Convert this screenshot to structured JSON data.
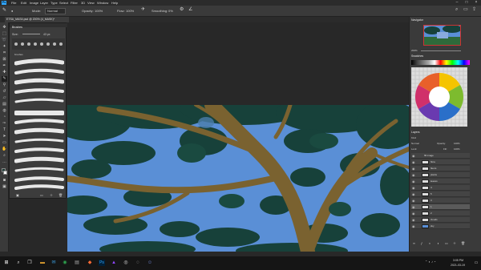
{
  "menubar": {
    "app_icon": "Ps",
    "items": [
      "File",
      "Edit",
      "Image",
      "Layer",
      "Type",
      "Select",
      "Filter",
      "3D",
      "View",
      "Window",
      "Help"
    ]
  },
  "options": {
    "mode_label": "Mode:",
    "mode_value": "Normal",
    "opacity_label": "Opacity:",
    "opacity_value": "100%",
    "flow_label": "Flow:",
    "flow_value": "100%",
    "smoothing_label": "Smoothing:",
    "smoothing_value": "0%"
  },
  "document": {
    "tab_title": "ETSA_MAS4.psd @ 200% (4_MASK)*"
  },
  "brush_panel": {
    "title": "Brushes",
    "size_label": "Size:",
    "size_value": "43 px",
    "group_label": "brushes"
  },
  "navigator": {
    "title": "Navigator",
    "zoom": "200%"
  },
  "swatches": {
    "title": "Swatches"
  },
  "layers": {
    "title": "Layers",
    "kind": "Kind",
    "blend": "Normal",
    "opacity_label": "Opacity:",
    "opacity_value": "100%",
    "lock_label": "Lock:",
    "fill_label": "Fill:",
    "fill_value": "100%",
    "group_name": "fill image",
    "items": [
      "flora",
      "fleurs",
      "plants",
      "leaves",
      "4",
      "5",
      "3",
      "1",
      "2",
      "clouds",
      "sky"
    ]
  },
  "taskbar": {
    "time": "3:05 PM",
    "date": "2021-03-19"
  },
  "colors": {
    "sky": "#5a8fd6",
    "foliage": "#17413a",
    "branch": "#7a6230",
    "accent": "#31a8ff"
  },
  "icons": {
    "start": "windows-icon",
    "search": "search-icon",
    "taskview": "task-view-icon"
  }
}
